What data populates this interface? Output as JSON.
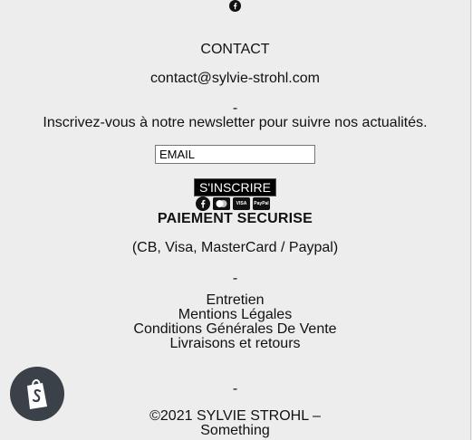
{
  "icons": {
    "facebook_top": "facebook-icon",
    "payment": [
      "facebook-icon",
      "mastercard-icon",
      "visa-icon",
      "paypal-icon"
    ]
  },
  "contact": {
    "title": "CONTACT",
    "email": "contact@sylvie-strohl.com"
  },
  "separator": "-",
  "newsletter": {
    "text": "Inscrivez-vous à notre newsletter pour suivre nos actualités.",
    "input_placeholder": "EMAIL",
    "input_value": "",
    "button_label": "S'INSCRIRE"
  },
  "payment": {
    "title": "PAIEMENT SECURISE",
    "subtitle": "(CB, Visa, MasterCard / Paypal)",
    "visa_label": "VISA",
    "paypal_label": "PayPal"
  },
  "links": [
    "Entretien",
    "Mentions Légales",
    "Conditions Générales De Vente",
    "Livraisons et retours"
  ],
  "copyright": {
    "line1": "©2021 SYLVIE STROHL –",
    "line2": "Something"
  },
  "colors": {
    "background": "#eeeded",
    "button_bg": "#000000",
    "shopify_badge": "#3b4148"
  }
}
